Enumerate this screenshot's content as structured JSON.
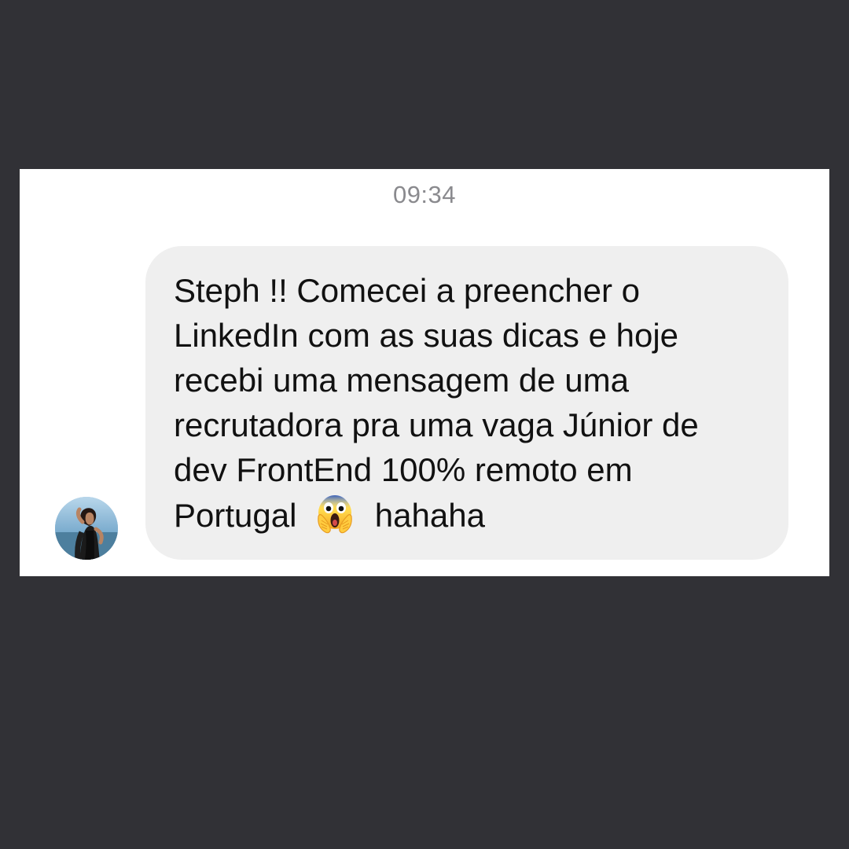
{
  "timestamp": "09:34",
  "message": {
    "lines": [
      "Steph !! Comecei a preencher o",
      "LinkedIn com as suas dicas e hoje",
      "recebi uma mensagem de uma",
      "recrutadora pra uma vaga Júnior de",
      "dev FrontEnd 100% remoto em"
    ],
    "last_line_before_emoji": "Portugal",
    "last_line_after_emoji": "hahaha",
    "emoji_icon": "face-screaming-in-fear-icon"
  },
  "avatar_icon": "profile-photo-avatar",
  "colors": {
    "background": "#313136",
    "card": "#ffffff",
    "bubble": "#efefef",
    "timestamp": "#8a8a8e",
    "text": "#111111"
  }
}
